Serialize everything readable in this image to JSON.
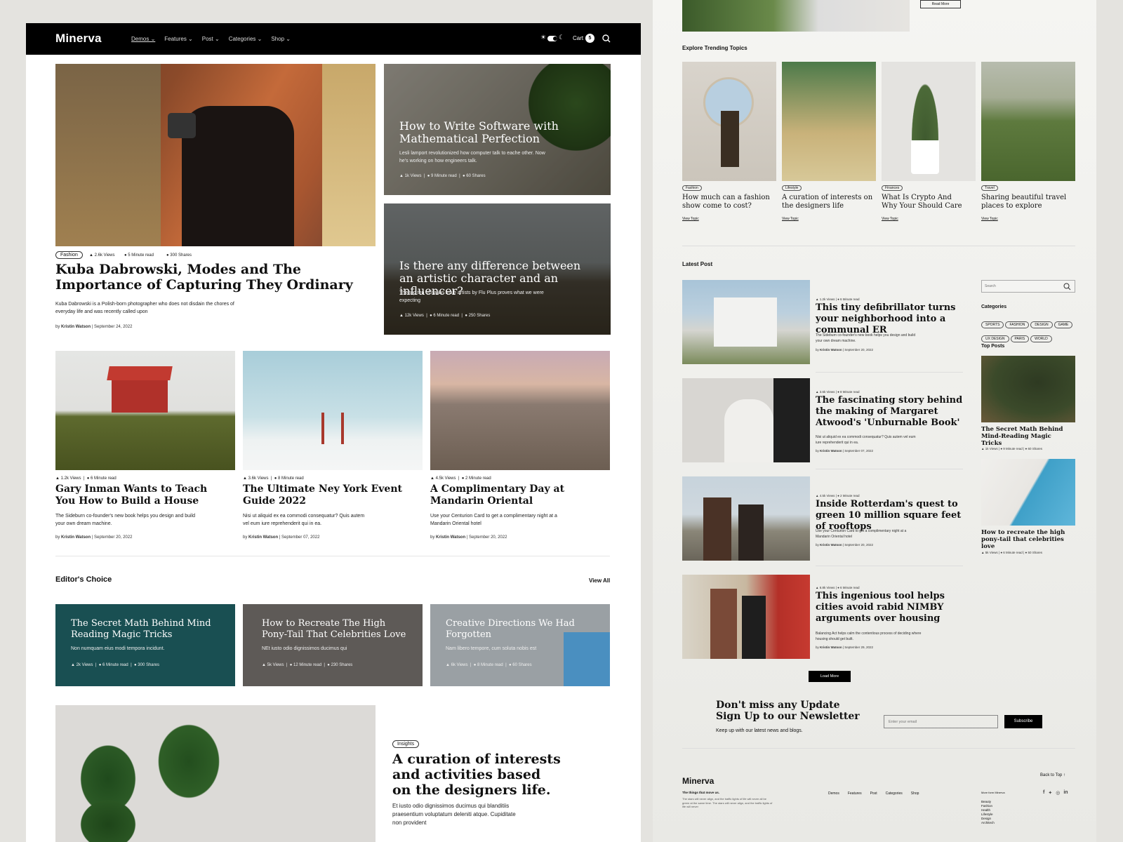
{
  "nav": {
    "logo": "Minerva",
    "menu": [
      "Demos ⌄",
      "Features ⌄",
      "Post ⌄",
      "Categories ⌄",
      "Shop ⌄"
    ],
    "cart_label": "Cart",
    "cart_count": "5"
  },
  "hero": {
    "tag": "Fashion",
    "views": "2.6k Views",
    "read": "5 Minute read",
    "shares": "300 Shares",
    "title": "Kuba Dabrowski, Modes and The Importance of Capturing They Ordinary",
    "desc": "Kuba Dabrowski is a Polish-born photographer who does not disdain the chores of everyday life and was recently called upon",
    "byline_prefix": "by",
    "author": "Kristin Watson",
    "date": "September 24, 2022"
  },
  "side_posts": [
    {
      "title": "How to Write Software with Mathematical Perfection",
      "desc": "Lesli lamport revolutionized how computer talk to eache other. Now he's working on how engineers talk.",
      "views": "1k Views",
      "read": "9 Minute read",
      "shares": "60 Shares"
    },
    {
      "title": "Is there any difference between an artistic character and an influencer?",
      "desc": "The top ten of Italian male artists by Flu Plus proves what we were expecting",
      "views": "12k Views",
      "read": "6 Minute read",
      "shares": "250 Shares"
    }
  ],
  "grid_posts": [
    {
      "views": "1.2k Views",
      "read": "6 Minute read",
      "title": "Gary Inman Wants to Teach You How to Build a House",
      "desc": "The Sideburn co-founder's new book helps you design and build your own dream machine.",
      "author": "Kristin Watson",
      "date": "September 20, 2022"
    },
    {
      "views": "3.6k Views",
      "read": "8 Minute read",
      "title": "The Ultimate Ney York Event Guide 2022",
      "desc": "Nisi ut aliquid ex ea commodi consequatur? Quis autem vel eum iure reprehenderit qui in ea.",
      "author": "Kristin Watson",
      "date": "September 07, 2022"
    },
    {
      "views": "4.5k Views",
      "read": "2 Minute read",
      "title": "A Complimentary Day at Mandarin Oriental",
      "desc": "Use your Centurion Card to get a complimentary night at a Mandarin Oriental hotel",
      "author": "Kristin Watson",
      "date": "September 20, 2022"
    }
  ],
  "editors": {
    "heading": "Editor's Choice",
    "view_all": "View All",
    "cards": [
      {
        "title": "The Secret Math Behind Mind Reading Magic Tricks",
        "desc": "Non numquam eius modi tempora incidunt.",
        "views": "2k Views",
        "read": "6 Minute read",
        "shares": "300 Shares",
        "color": "#1d5a5e"
      },
      {
        "title": "How to Recreate The High Pony-Tail That Celebrities Love",
        "desc": "NEt iusto odio dignissimos ducimus qui",
        "views": "5k Views",
        "read": "12 Minute read",
        "shares": "230 Shares",
        "color": "#5e5a57"
      },
      {
        "title": "Creative Directions We Had Forgotten",
        "desc": "Nam libero tempore, cum soluta nobis est",
        "views": "6k Views",
        "read": "8 Minute read",
        "shares": "60 Shares",
        "color": "#9aa0a4"
      }
    ]
  },
  "insight": {
    "tag": "Insights",
    "title": "A curation of interests and activities based on the designers life.",
    "desc": "Et iusto odio dignissimos ducimus qui blanditiis praesentium voluptatum deleniti atque. Cupiditate non provident"
  },
  "right": {
    "read_more": "Read More",
    "trending_heading": "Explore Trending Topics",
    "view_topic": "View Topic",
    "topics": [
      {
        "badge": "Fashion",
        "title": "How much can a fashion show come to cost?"
      },
      {
        "badge": "Lifestyle",
        "title": "A curation of interests on the designers life"
      },
      {
        "badge": "Finances",
        "title": "What Is Crypto And Why Your Should Care"
      },
      {
        "badge": "Travel",
        "title": "Sharing beautiful travel places to explore"
      }
    ],
    "latest_heading": "Latest Post",
    "latest": [
      {
        "views": "1.2k Views",
        "read": "6 Minute read",
        "title": "This tiny defibrillator turns your neighborhood into a communal ER",
        "desc": "The Sideburn co-founder's new book helps you design and build your own dream machine.",
        "author": "Kristin Watson",
        "date": "September 20, 2022"
      },
      {
        "views": "3.6k Views",
        "read": "8 Minute read",
        "title": "The fascinating story behind the making of Margaret Atwood's 'Unburnable Book'",
        "desc": "Nisi ut aliquid ex ea commodi consequatur? Quis autem vel eum iure reprehenderit qui in ea.",
        "author": "Kristin Watson",
        "date": "September 07, 2022"
      },
      {
        "views": "4.5k Views",
        "read": "2 Minute read",
        "title": "Inside Rotterdam's quest to green 10 million square feet of rooftops",
        "desc": "Use your Centurion Card to get a complimentary night at a Mandarin Oriental hotel",
        "author": "Kristin Watson",
        "date": "September 20, 2022"
      },
      {
        "views": "6.8k Views",
        "read": "6 Minute read",
        "title": "This ingenious tool helps cities avoid rabid NIMBY arguments over housing",
        "desc": "Balancing Act helps calm the contentious process of deciding where housing should get built.",
        "author": "Kristin Watson",
        "date": "September 29, 2022"
      }
    ],
    "load_more": "Load More",
    "search_placeholder": "Search",
    "categories_heading": "Categories",
    "categories": [
      "SPORTS",
      "FASHION",
      "DESIGN",
      "GAME",
      "UX DESIGN",
      "PARIS",
      "WORLD"
    ],
    "top_posts_heading": "Top Posts",
    "top_posts": [
      {
        "title": "The Secret Math Behind Mind-Reading Magic Tricks",
        "views": "1k Views",
        "read": "9 Minute read",
        "shares": "60 Shares"
      },
      {
        "title": "How to recreate the high pony-tail that celebrities love",
        "views": "5k Views",
        "read": "6 Minute read",
        "shares": "50 Shares"
      }
    ],
    "newsletter": {
      "title1": "Don't miss any Update",
      "title2": "Sign Up to our Newsletter",
      "sub": "Keep up with our latest news and blogs.",
      "placeholder": "Enter your email",
      "button": "Subscribe"
    },
    "footer": {
      "logo": "Minerva",
      "tagline": "The things that move us.",
      "about": "The stars will never align, and the traffic lights of life will never all be green at the same time. The stars will never align, and the traffic lights of life will never",
      "links": [
        "Demos",
        "Features",
        "Post",
        "Categories",
        "Shop"
      ],
      "more_heading": "More form Minerva",
      "more": [
        "Beauty",
        "Fashion",
        "Health",
        "Lifestyle",
        "Design",
        "Architech"
      ],
      "back_to_top": "Back to Top ↑"
    }
  }
}
